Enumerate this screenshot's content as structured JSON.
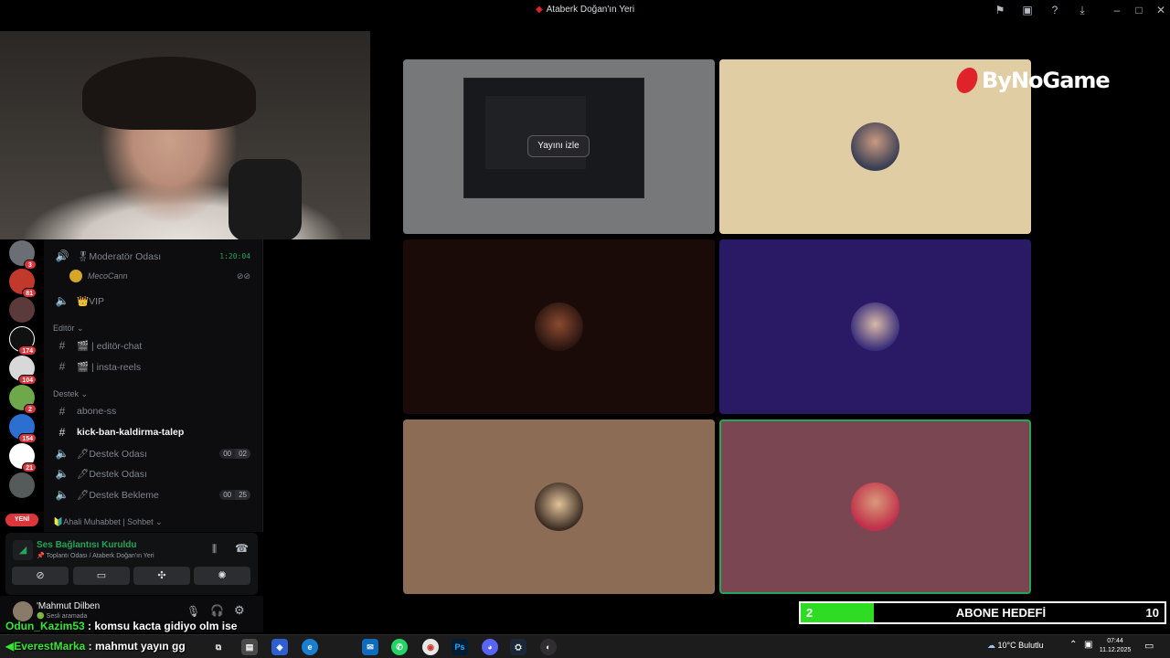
{
  "window": {
    "title": "Ataberk Doğan'ın Yeri"
  },
  "servers": [
    {
      "badge": "3"
    },
    {
      "badge": "81"
    },
    {
      "badge": ""
    },
    {
      "badge": "174"
    },
    {
      "badge": "104"
    },
    {
      "badge": "2"
    },
    {
      "badge": "154"
    },
    {
      "badge": "21"
    },
    {
      "badge": ""
    }
  ],
  "new_badge": "YENİ",
  "channels": {
    "moderator_room": {
      "name": "🎖Moderatör Odası",
      "time": "1:20:04"
    },
    "moderator_member": "MecoCann",
    "vip": "👑VIP",
    "category_editor": "Editör ⌄",
    "editor_chat": "🎬 | editör-chat",
    "insta_reels": "🎬 | insta-reels",
    "category_support": "Destek ⌄",
    "abone_ss": "abone-ss",
    "kick_ban": "kick-ban-kaldirma-talep",
    "support_room_1": {
      "name": "🖊Destek Odası",
      "count": "00",
      "limit": "02"
    },
    "support_room_2": {
      "name": "🖊Destek Odası"
    },
    "support_waiting": {
      "name": "🖊Destek Bekleme",
      "count": "00",
      "limit": "25"
    },
    "category_chat": "🔰Ahali Muhabbet | Sohbet ⌄"
  },
  "voice_panel": {
    "status": "Ses Bağlantısı Kuruldu",
    "location": "📌 Toplantı Odası / Ataberk Doğan'ın Yeri"
  },
  "user_panel": {
    "name": "'Mahmut Dilben",
    "status": "🟢 Sesli aramada"
  },
  "stream": {
    "watch_label": "Yayını izle"
  },
  "tile_colors": {
    "t2": "#e0cda4",
    "t3": "#1a0a08",
    "t4": "#2a1a66",
    "t5": "#8c6c55",
    "t6": "#7a4652"
  },
  "brand": "ByNoGame",
  "goal": {
    "current": "2",
    "label": "ABONE HEDEFİ",
    "target": "10",
    "progress": 0.2
  },
  "chat": [
    {
      "user": "Odun_Kazim53",
      "message": ": komsu kacta gidiyo olm ise"
    },
    {
      "user": "EverestMarka",
      "message": ": mahmut yayın gg"
    }
  ],
  "taskbar": {
    "weather": "10°C  Bulutlu",
    "time": "07:44",
    "date": "11.12.2025"
  }
}
